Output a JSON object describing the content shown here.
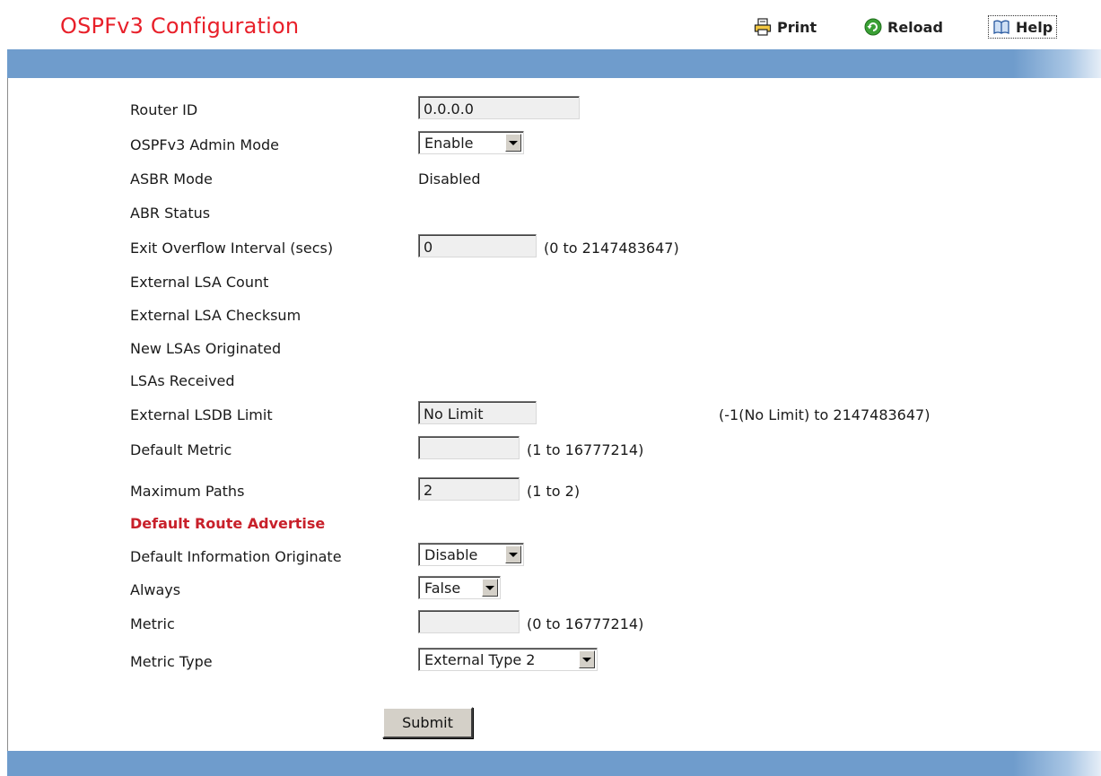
{
  "header": {
    "title": "OSPFv3 Configuration",
    "print_label": "Print",
    "reload_label": "Reload",
    "help_label": "Help",
    "icons": {
      "print": "printer-icon",
      "reload": "reload-icon",
      "help": "help-book-icon"
    }
  },
  "colors": {
    "title": "#e8202a",
    "bar": "#6f9ccc",
    "section": "#c8202a",
    "reload_icon": "#3aa035"
  },
  "form": {
    "router_id": {
      "label": "Router ID",
      "value": "0.0.0.0"
    },
    "admin_mode": {
      "label": "OSPFv3 Admin Mode",
      "selected": "Enable"
    },
    "asbr_mode": {
      "label": "ASBR Mode",
      "value": "Disabled"
    },
    "abr_status": {
      "label": "ABR Status",
      "value": ""
    },
    "exit_overflow": {
      "label": "Exit Overflow Interval (secs)",
      "value": "0",
      "hint": "(0 to 2147483647)"
    },
    "ext_lsa_count": {
      "label": "External LSA Count"
    },
    "ext_lsa_checksum": {
      "label": "External LSA Checksum"
    },
    "new_lsas": {
      "label": "New LSAs Originated"
    },
    "lsas_received": {
      "label": "LSAs Received"
    },
    "ext_lsdb_limit": {
      "label": "External LSDB Limit",
      "value": "No Limit",
      "hint": "(-1(No Limit) to 2147483647)"
    },
    "default_metric": {
      "label": "Default Metric",
      "value": "",
      "hint": "(1 to 16777214)"
    },
    "max_paths": {
      "label": "Maximum Paths",
      "value": "2",
      "hint": "(1 to 2)"
    },
    "section_default_route": "Default Route Advertise",
    "default_info_originate": {
      "label": "Default Information Originate",
      "selected": "Disable"
    },
    "always": {
      "label": "Always",
      "selected": "False"
    },
    "metric": {
      "label": "Metric",
      "value": "",
      "hint": "(0 to 16777214)"
    },
    "metric_type": {
      "label": "Metric Type",
      "selected": "External Type 2"
    }
  },
  "submit_label": "Submit"
}
